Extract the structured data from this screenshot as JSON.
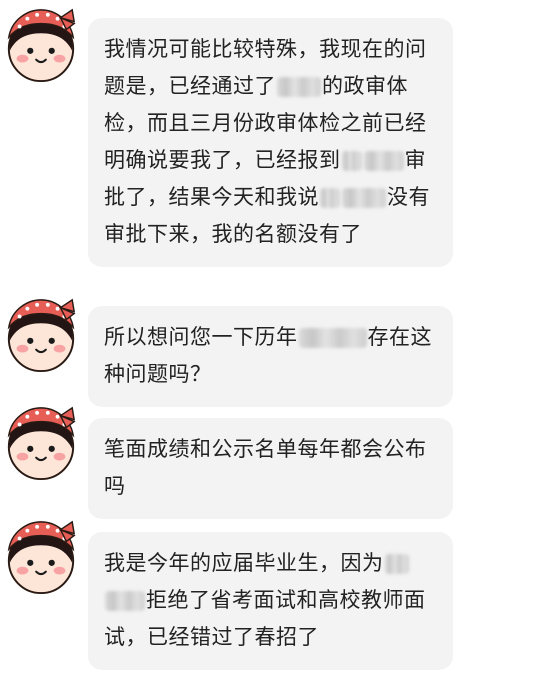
{
  "messages": [
    {
      "segments": [
        {
          "type": "text",
          "value": "我情况可能比较特殊，我现在的问题是，已经通过了"
        },
        {
          "type": "blur",
          "width": 44
        },
        {
          "type": "text",
          "value": "的政审体检，而且三月份政审体检之前已经明确说要我了，已经报到"
        },
        {
          "type": "blur",
          "width": 20
        },
        {
          "type": "blur",
          "width": 40
        },
        {
          "type": "text",
          "value": "审批了，结果今天和我说"
        },
        {
          "type": "blur",
          "width": 20
        },
        {
          "type": "blur",
          "width": 44
        },
        {
          "type": "text",
          "value": "没有审批下来，我的名额没有了"
        }
      ]
    },
    {
      "segments": [
        {
          "type": "text",
          "value": "所以想问您一下历年"
        },
        {
          "type": "blur",
          "width": 68
        },
        {
          "type": "text",
          "value": "存在这种问题吗？"
        }
      ]
    },
    {
      "segments": [
        {
          "type": "text",
          "value": "笔面成绩和公示名单每年都会公布吗"
        }
      ]
    },
    {
      "segments": [
        {
          "type": "text",
          "value": "我是今年的应届毕业生，因为"
        },
        {
          "type": "blur",
          "width": 24
        },
        {
          "type": "blur",
          "width": 40
        },
        {
          "type": "text",
          "value": "拒绝了省考面试和高校教师面试，已经错过了春招了"
        }
      ]
    }
  ]
}
